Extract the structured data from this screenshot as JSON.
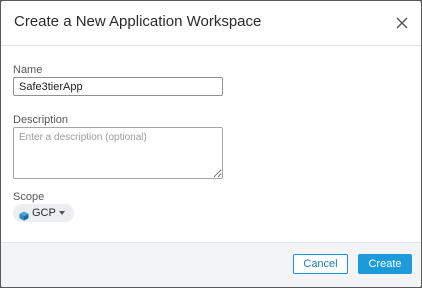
{
  "dialog": {
    "title": "Create a New Application Workspace",
    "close_icon": "close-icon"
  },
  "form": {
    "name_label": "Name",
    "name_value": "Safe3tierApp",
    "description_label": "Description",
    "description_placeholder": "Enter a description (optional)",
    "description_value": "",
    "scope_label": "Scope",
    "scope_value": "GCP",
    "scope_icon": "cube-icon"
  },
  "footer": {
    "cancel_label": "Cancel",
    "create_label": "Create"
  },
  "colors": {
    "primary": "#1d9bd8",
    "secondary_border": "#1e8fd0",
    "footer_bg": "#f3f4f5",
    "backdrop": "#5a5a5a"
  }
}
